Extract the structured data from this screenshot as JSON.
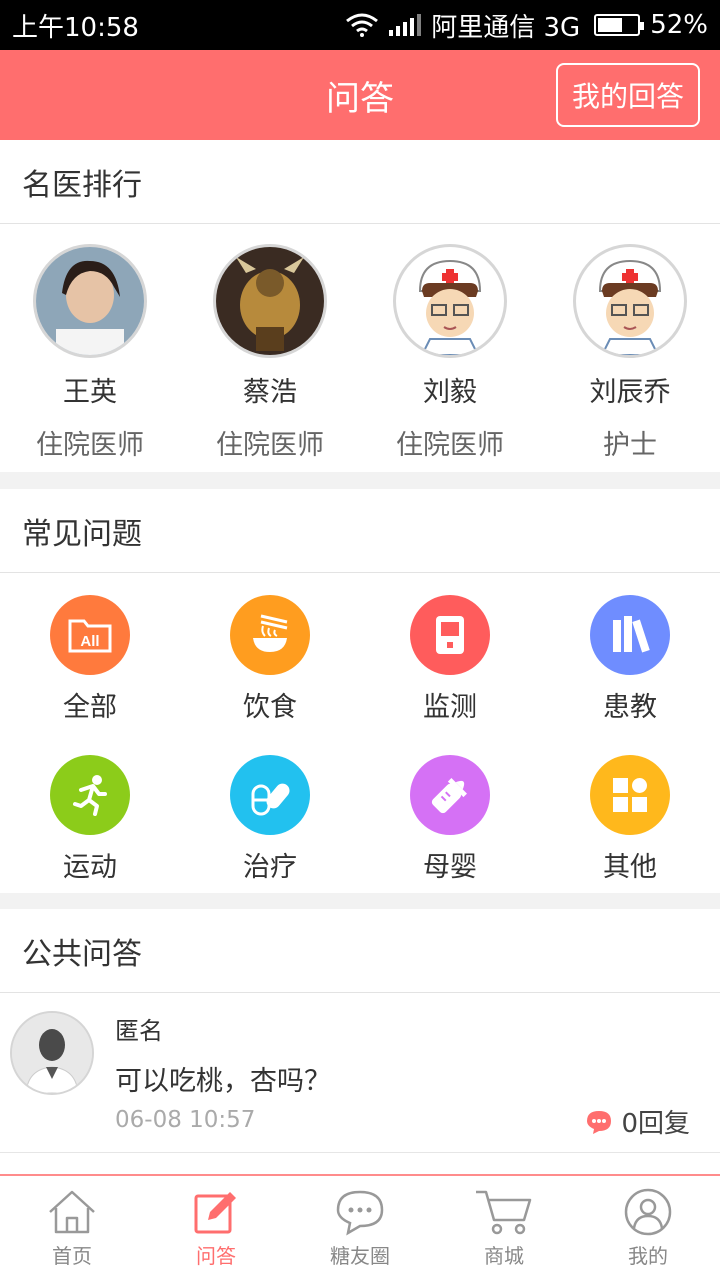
{
  "status_bar": {
    "time": "上午10:58",
    "carrier": "阿里通信 3G",
    "battery": "52%"
  },
  "header": {
    "title": "问答",
    "my_answers": "我的回答"
  },
  "doctors_section": {
    "title": "名医排行",
    "doctors": [
      {
        "name": "王英",
        "role": "住院医师"
      },
      {
        "name": "蔡浩",
        "role": "住院医师"
      },
      {
        "name": "刘毅",
        "role": "住院医师"
      },
      {
        "name": "刘辰乔",
        "role": "护士"
      }
    ]
  },
  "faq_section": {
    "title": "常见问题",
    "categories": [
      {
        "label": "全部",
        "color": "#ff7a3d",
        "icon": "folder-all-icon"
      },
      {
        "label": "饮食",
        "color": "#ff9d1f",
        "icon": "noodle-bowl-icon"
      },
      {
        "label": "监测",
        "color": "#ff5c5c",
        "icon": "glucose-meter-icon"
      },
      {
        "label": "患教",
        "color": "#6f8dff",
        "icon": "books-icon"
      },
      {
        "label": "运动",
        "color": "#8ccc1a",
        "icon": "running-man-icon"
      },
      {
        "label": "治疗",
        "color": "#22c1ef",
        "icon": "pill-icon"
      },
      {
        "label": "母婴",
        "color": "#d571f5",
        "icon": "baby-bottle-icon"
      },
      {
        "label": "其他",
        "color": "#ffb81c",
        "icon": "grid-icon"
      }
    ]
  },
  "public_qa": {
    "title": "公共问答",
    "items": [
      {
        "name": "匿名",
        "question": "可以吃桃，杏吗？",
        "time": "06-08 10:57",
        "replies": "0回复"
      }
    ]
  },
  "bottom_nav": {
    "items": [
      {
        "label": "首页"
      },
      {
        "label": "问答"
      },
      {
        "label": "糖友圈"
      },
      {
        "label": "商城"
      },
      {
        "label": "我的"
      }
    ]
  },
  "colors": {
    "accent": "#ff6e6e"
  }
}
